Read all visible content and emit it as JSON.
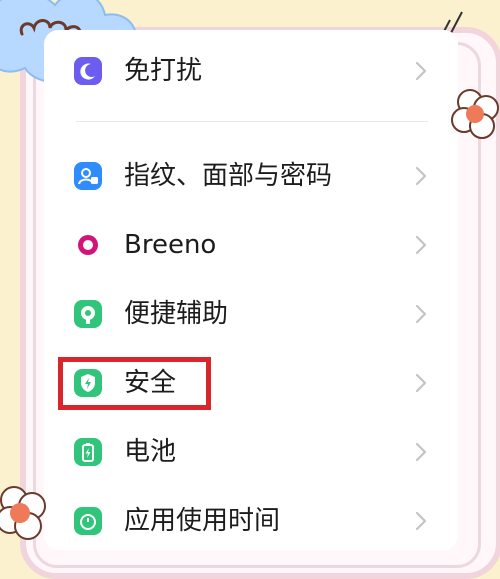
{
  "settings": {
    "items": [
      {
        "label": "免打扰",
        "icon": "moon-icon",
        "color": "#6c5cf0"
      },
      {
        "label": "指纹、面部与密码",
        "icon": "fingerprint-face-icon",
        "color": "#2f8cff"
      },
      {
        "label": "Breeno",
        "icon": "breeno-ring-icon",
        "color": "#d2147a"
      },
      {
        "label": "便捷辅助",
        "icon": "assist-icon",
        "color": "#31c57c"
      },
      {
        "label": "安全",
        "icon": "shield-icon",
        "color": "#31c57c"
      },
      {
        "label": "电池",
        "icon": "battery-icon",
        "color": "#31c57c"
      },
      {
        "label": "应用使用时间",
        "icon": "timer-icon",
        "color": "#31c57c"
      }
    ]
  },
  "highlight": {
    "target": "安全",
    "color": "#d8272c"
  }
}
